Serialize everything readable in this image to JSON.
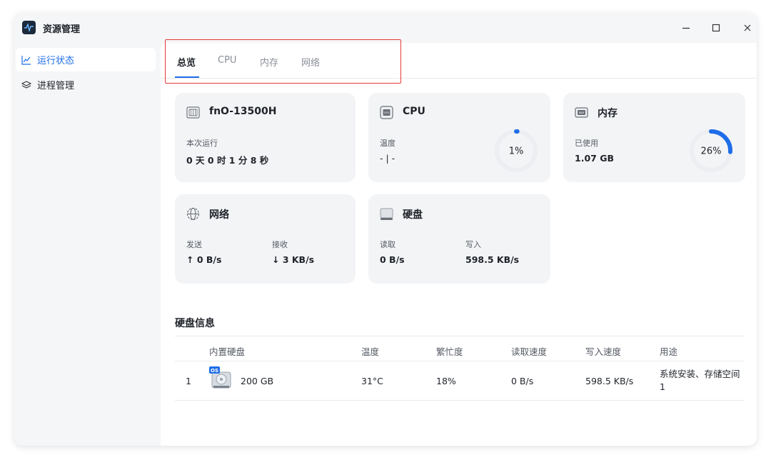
{
  "app": {
    "title": "资源管理"
  },
  "window_controls": {
    "minimize": "—",
    "maximize": "☐",
    "close": "✕"
  },
  "sidebar": {
    "items": [
      {
        "label": "运行状态",
        "icon": "line-chart-icon",
        "active": true
      },
      {
        "label": "进程管理",
        "icon": "layers-icon",
        "active": false
      }
    ]
  },
  "tabs": [
    {
      "label": "总览",
      "active": true
    },
    {
      "label": "CPU",
      "active": false
    },
    {
      "label": "内存",
      "active": false
    },
    {
      "label": "网络",
      "active": false
    }
  ],
  "cards": {
    "system": {
      "title": "fnO-13500H",
      "uptime_label": "本次运行",
      "uptime_value": "0 天 0 时 1 分 8 秒"
    },
    "cpu": {
      "title": "CPU",
      "temp_label": "温度",
      "temp_value": "- | -",
      "usage_percent": 1,
      "usage_text": "1%"
    },
    "memory": {
      "title": "内存",
      "used_label": "已使用",
      "used_value": "1.07 GB",
      "usage_percent": 26,
      "usage_text": "26%"
    },
    "network": {
      "title": "网络",
      "send_label": "发送",
      "send_value": "↑ 0 B/s",
      "recv_label": "接收",
      "recv_value": "↓ 3 KB/s"
    },
    "disk": {
      "title": "硬盘",
      "read_label": "读取",
      "read_value": "0 B/s",
      "write_label": "写入",
      "write_value": "598.5 KB/s"
    }
  },
  "disk_info": {
    "title": "硬盘信息",
    "columns": [
      "内置硬盘",
      "温度",
      "繁忙度",
      "读取速度",
      "写入速度",
      "用途"
    ],
    "rows": [
      {
        "index": "1",
        "badge": "OS",
        "size": "200 GB",
        "temp": "31°C",
        "busy": "18%",
        "read": "0 B/s",
        "write": "598.5 KB/s",
        "usage": "系统安装、存储空间 1"
      }
    ]
  },
  "colors": {
    "accent": "#1f6de8",
    "ring_track": "#eceef1",
    "highlight": "#e53935"
  }
}
